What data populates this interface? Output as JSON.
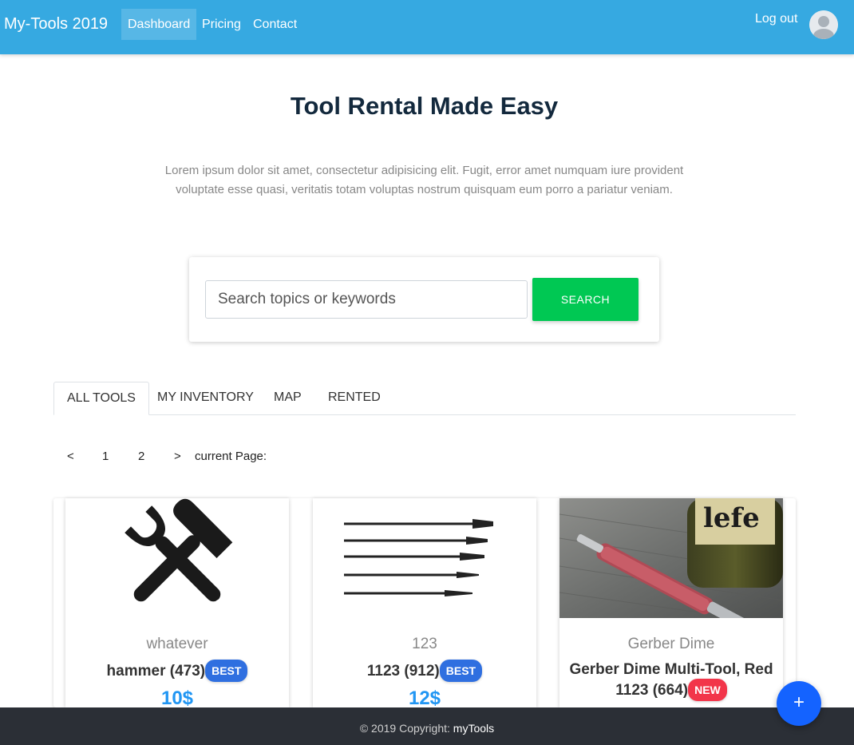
{
  "navbar": {
    "brand": "My-Tools 2019",
    "links": [
      "Dashboard",
      "Pricing",
      "Contact"
    ],
    "active": "Dashboard",
    "logout": "Log out",
    "color": "#36a9e1"
  },
  "hero": {
    "title": "Tool Rental Made Easy",
    "text": "Lorem ipsum dolor sit amet, consectetur adipisicing elit. Fugit, error amet numquam iure provident voluptate esse quasi, veritatis totam voluptas nostrum quisquam eum porro a pariatur veniam."
  },
  "search": {
    "placeholder": "Search topics or keywords",
    "value": "",
    "button_label": "SEARCH",
    "button_color": "#00c853"
  },
  "tabs": {
    "items": [
      "ALL TOOLS",
      "MY INVENTORY",
      "MAP",
      "RENTED"
    ],
    "active": "ALL TOOLS"
  },
  "pagination": {
    "prev": "<",
    "pages": [
      "1",
      "2"
    ],
    "next": ">",
    "current_label": "current Page:"
  },
  "cards": [
    {
      "image": "hammer-wrench-icon",
      "subtitle": "whatever",
      "title": "hammer (473)",
      "badge": "BEST",
      "price": "10$"
    },
    {
      "image": "drill-bits-image",
      "subtitle": "123",
      "title": "1123 (912)",
      "badge": "BEST",
      "price": "12$"
    },
    {
      "image": "multi-tool-photo",
      "subtitle": "Gerber Dime",
      "title": "Gerber Dime Multi-Tool, Red 1123 (664)",
      "badge": "NEW",
      "price": ""
    }
  ],
  "footer": {
    "text": "© 2019 Copyright:",
    "brand": "myTools"
  },
  "fab": {
    "label": "+",
    "color": "#1463ff"
  }
}
